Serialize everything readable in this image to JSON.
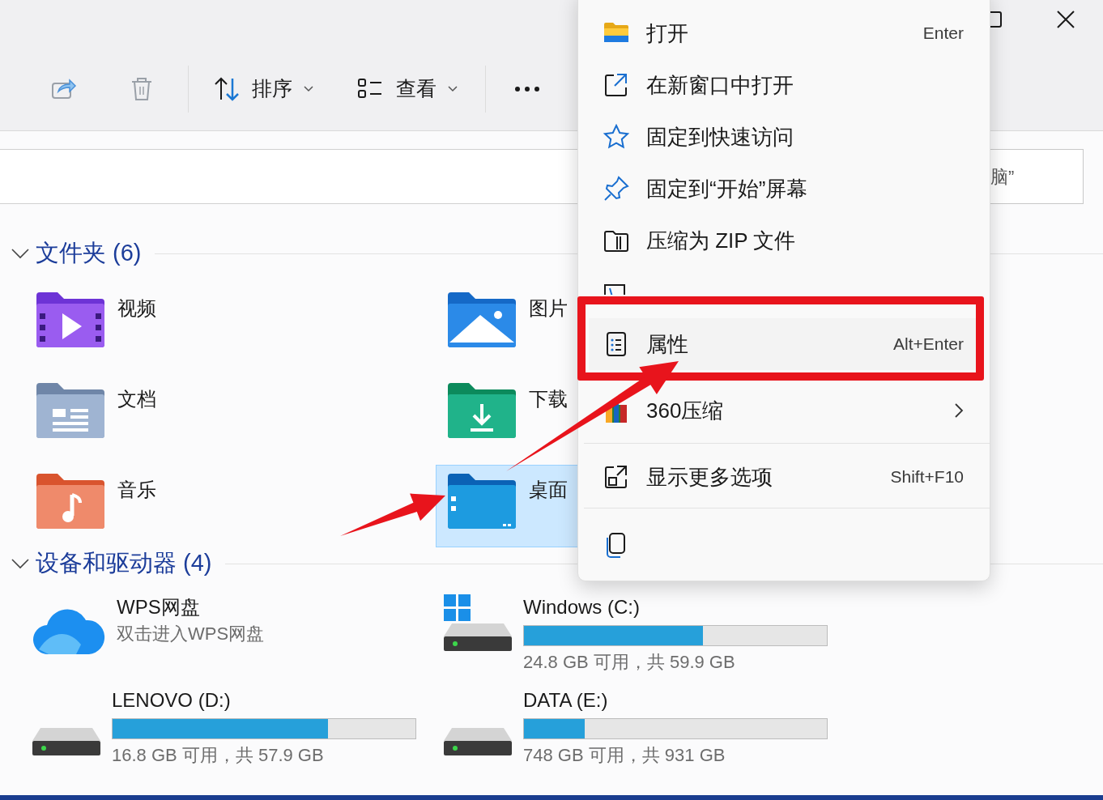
{
  "toolbar": [
    {
      "kind": "share"
    },
    {
      "kind": "delete"
    },
    {
      "kind": "sort",
      "label": "排序"
    },
    {
      "kind": "view",
      "label": "查看"
    },
    {
      "kind": "more"
    }
  ],
  "search": {
    "placeholder": "脑”"
  },
  "folders_section": {
    "title": "文件夹 (6)",
    "expanded": true
  },
  "folders": [
    {
      "name": "视频",
      "kind": "video",
      "selected": false
    },
    {
      "name": "图片",
      "kind": "pictures",
      "selected": false
    },
    {
      "name": "文档",
      "kind": "documents",
      "selected": false
    },
    {
      "name": "下载",
      "kind": "downloads",
      "selected": false
    },
    {
      "name": "音乐",
      "kind": "music",
      "selected": false
    },
    {
      "name": "桌面",
      "kind": "desktop",
      "selected": true
    }
  ],
  "drives_section": {
    "title": "设备和驱动器 (4)",
    "expanded": true
  },
  "drives": [
    {
      "kind": "cloud",
      "name": "WPS网盘",
      "subtitle": "双击进入WPS网盘"
    },
    {
      "kind": "system",
      "name": "Windows (C:)",
      "level": 0.59,
      "reading": "24.8 GB 可用，共 59.9 GB"
    },
    {
      "kind": "drive",
      "name": "LENOVO (D:)",
      "level": 0.71,
      "reading": "16.8 GB 可用，共 57.9 GB"
    },
    {
      "kind": "drive",
      "name": "DATA (E:)",
      "level": 0.2,
      "reading": "748 GB 可用，共 931 GB"
    }
  ],
  "context_menu": [
    {
      "kind": "open",
      "label": "打开",
      "shortcut": "Enter"
    },
    {
      "kind": "new_window",
      "label": "在新窗口中打开"
    },
    {
      "kind": "star",
      "label": "固定到快速访问"
    },
    {
      "kind": "pin",
      "label": "固定到“开始”屏幕"
    },
    {
      "kind": "zip",
      "label": "压缩为 ZIP 文件"
    },
    {
      "kind": "copy_path"
    },
    {
      "kind": "properties",
      "label": "属性",
      "shortcut": "Alt+Enter",
      "highlighted": true
    },
    {
      "kind": "app360",
      "label": "360压缩",
      "submenu": true
    },
    {
      "kind": "more_options",
      "label": "显示更多选项",
      "shortcut": "Shift+F10"
    }
  ],
  "context_menu_actions": [
    {
      "kind": "copy"
    }
  ]
}
